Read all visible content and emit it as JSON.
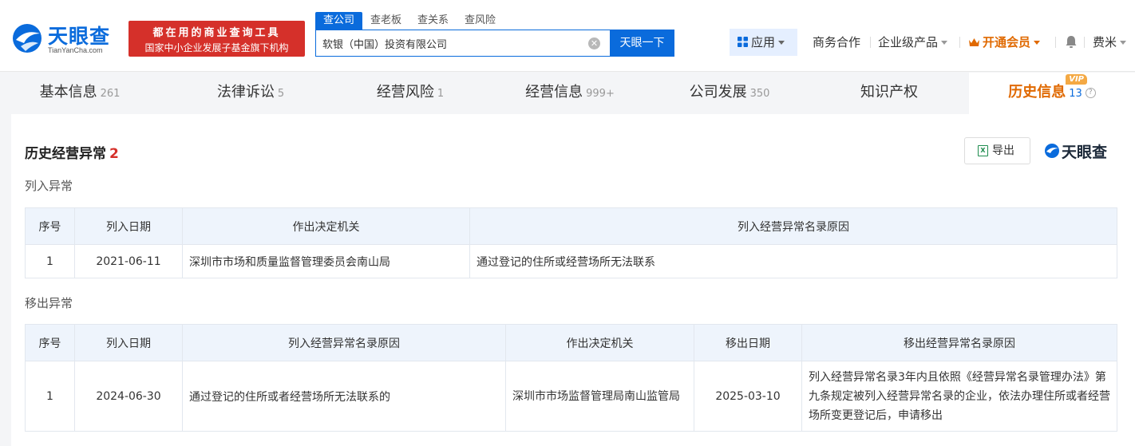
{
  "header": {
    "logo_text": "天眼查",
    "logo_sub": "TianYanCha.com",
    "banner_line1": "都在用的商业查询工具",
    "banner_line2": "国家中小企业发展子基金旗下机构",
    "search_tabs": [
      "查公司",
      "查老板",
      "查关系",
      "查风险"
    ],
    "search_value": "软银（中国）投资有限公司",
    "search_button": "天眼一下",
    "nav_apps": "应用",
    "nav_business": "商务合作",
    "nav_enterprise": "企业级产品",
    "nav_vip": "开通会员",
    "user_name": "费米"
  },
  "tabs": [
    {
      "label": "基本信息",
      "count": "261"
    },
    {
      "label": "法律诉讼",
      "count": "5"
    },
    {
      "label": "经营风险",
      "count": "1"
    },
    {
      "label": "经营信息",
      "count": "999+"
    },
    {
      "label": "公司发展",
      "count": "350"
    },
    {
      "label": "知识产权",
      "count": ""
    },
    {
      "label": "历史信息",
      "count": "13",
      "badge": "VIP"
    }
  ],
  "section": {
    "title": "历史经营异常",
    "count": "2",
    "export_label": "导出",
    "watermark": "天眼查"
  },
  "listed": {
    "title": "列入异常",
    "headers": [
      "序号",
      "列入日期",
      "作出决定机关",
      "列入经营异常名录原因"
    ],
    "rows": [
      [
        "1",
        "2021-06-11",
        "深圳市市场和质量监督管理委员会南山局",
        "通过登记的住所或经营场所无法联系"
      ]
    ]
  },
  "removed": {
    "title": "移出异常",
    "headers": [
      "序号",
      "列入日期",
      "列入经营异常名录原因",
      "作出决定机关",
      "移出日期",
      "移出经营异常名录原因"
    ],
    "rows": [
      [
        "1",
        "2024-06-30",
        "通过登记的住所或者经营场所无法联系的",
        "深圳市市场监督管理局南山监管局",
        "2025-03-10",
        "列入经营异常名录3年内且依照《经营异常名录管理办法》第九条规定被列入经营异常名录的企业，依法办理住所或者经营场所变更登记后，申请移出"
      ]
    ]
  }
}
